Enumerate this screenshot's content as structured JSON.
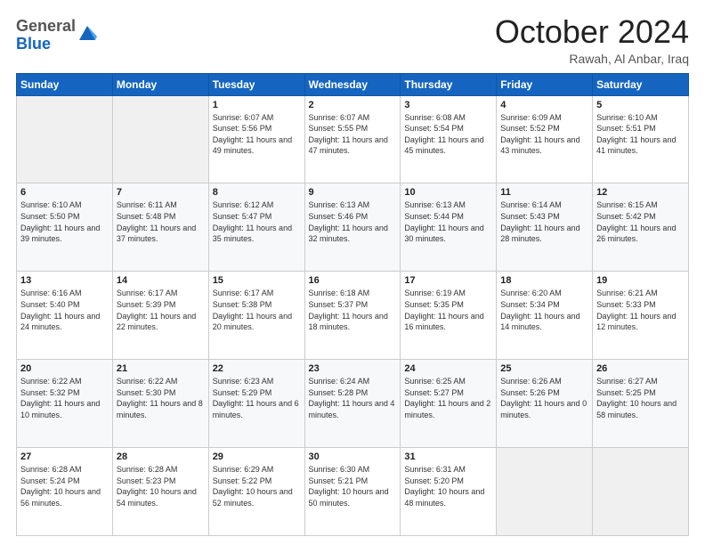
{
  "header": {
    "logo_general": "General",
    "logo_blue": "Blue",
    "month_title": "October 2024",
    "location": "Rawah, Al Anbar, Iraq"
  },
  "days_of_week": [
    "Sunday",
    "Monday",
    "Tuesday",
    "Wednesday",
    "Thursday",
    "Friday",
    "Saturday"
  ],
  "weeks": [
    [
      {
        "day": "",
        "info": ""
      },
      {
        "day": "",
        "info": ""
      },
      {
        "day": "1",
        "info": "Sunrise: 6:07 AM\nSunset: 5:56 PM\nDaylight: 11 hours and 49 minutes."
      },
      {
        "day": "2",
        "info": "Sunrise: 6:07 AM\nSunset: 5:55 PM\nDaylight: 11 hours and 47 minutes."
      },
      {
        "day": "3",
        "info": "Sunrise: 6:08 AM\nSunset: 5:54 PM\nDaylight: 11 hours and 45 minutes."
      },
      {
        "day": "4",
        "info": "Sunrise: 6:09 AM\nSunset: 5:52 PM\nDaylight: 11 hours and 43 minutes."
      },
      {
        "day": "5",
        "info": "Sunrise: 6:10 AM\nSunset: 5:51 PM\nDaylight: 11 hours and 41 minutes."
      }
    ],
    [
      {
        "day": "6",
        "info": "Sunrise: 6:10 AM\nSunset: 5:50 PM\nDaylight: 11 hours and 39 minutes."
      },
      {
        "day": "7",
        "info": "Sunrise: 6:11 AM\nSunset: 5:48 PM\nDaylight: 11 hours and 37 minutes."
      },
      {
        "day": "8",
        "info": "Sunrise: 6:12 AM\nSunset: 5:47 PM\nDaylight: 11 hours and 35 minutes."
      },
      {
        "day": "9",
        "info": "Sunrise: 6:13 AM\nSunset: 5:46 PM\nDaylight: 11 hours and 32 minutes."
      },
      {
        "day": "10",
        "info": "Sunrise: 6:13 AM\nSunset: 5:44 PM\nDaylight: 11 hours and 30 minutes."
      },
      {
        "day": "11",
        "info": "Sunrise: 6:14 AM\nSunset: 5:43 PM\nDaylight: 11 hours and 28 minutes."
      },
      {
        "day": "12",
        "info": "Sunrise: 6:15 AM\nSunset: 5:42 PM\nDaylight: 11 hours and 26 minutes."
      }
    ],
    [
      {
        "day": "13",
        "info": "Sunrise: 6:16 AM\nSunset: 5:40 PM\nDaylight: 11 hours and 24 minutes."
      },
      {
        "day": "14",
        "info": "Sunrise: 6:17 AM\nSunset: 5:39 PM\nDaylight: 11 hours and 22 minutes."
      },
      {
        "day": "15",
        "info": "Sunrise: 6:17 AM\nSunset: 5:38 PM\nDaylight: 11 hours and 20 minutes."
      },
      {
        "day": "16",
        "info": "Sunrise: 6:18 AM\nSunset: 5:37 PM\nDaylight: 11 hours and 18 minutes."
      },
      {
        "day": "17",
        "info": "Sunrise: 6:19 AM\nSunset: 5:35 PM\nDaylight: 11 hours and 16 minutes."
      },
      {
        "day": "18",
        "info": "Sunrise: 6:20 AM\nSunset: 5:34 PM\nDaylight: 11 hours and 14 minutes."
      },
      {
        "day": "19",
        "info": "Sunrise: 6:21 AM\nSunset: 5:33 PM\nDaylight: 11 hours and 12 minutes."
      }
    ],
    [
      {
        "day": "20",
        "info": "Sunrise: 6:22 AM\nSunset: 5:32 PM\nDaylight: 11 hours and 10 minutes."
      },
      {
        "day": "21",
        "info": "Sunrise: 6:22 AM\nSunset: 5:30 PM\nDaylight: 11 hours and 8 minutes."
      },
      {
        "day": "22",
        "info": "Sunrise: 6:23 AM\nSunset: 5:29 PM\nDaylight: 11 hours and 6 minutes."
      },
      {
        "day": "23",
        "info": "Sunrise: 6:24 AM\nSunset: 5:28 PM\nDaylight: 11 hours and 4 minutes."
      },
      {
        "day": "24",
        "info": "Sunrise: 6:25 AM\nSunset: 5:27 PM\nDaylight: 11 hours and 2 minutes."
      },
      {
        "day": "25",
        "info": "Sunrise: 6:26 AM\nSunset: 5:26 PM\nDaylight: 11 hours and 0 minutes."
      },
      {
        "day": "26",
        "info": "Sunrise: 6:27 AM\nSunset: 5:25 PM\nDaylight: 10 hours and 58 minutes."
      }
    ],
    [
      {
        "day": "27",
        "info": "Sunrise: 6:28 AM\nSunset: 5:24 PM\nDaylight: 10 hours and 56 minutes."
      },
      {
        "day": "28",
        "info": "Sunrise: 6:28 AM\nSunset: 5:23 PM\nDaylight: 10 hours and 54 minutes."
      },
      {
        "day": "29",
        "info": "Sunrise: 6:29 AM\nSunset: 5:22 PM\nDaylight: 10 hours and 52 minutes."
      },
      {
        "day": "30",
        "info": "Sunrise: 6:30 AM\nSunset: 5:21 PM\nDaylight: 10 hours and 50 minutes."
      },
      {
        "day": "31",
        "info": "Sunrise: 6:31 AM\nSunset: 5:20 PM\nDaylight: 10 hours and 48 minutes."
      },
      {
        "day": "",
        "info": ""
      },
      {
        "day": "",
        "info": ""
      }
    ]
  ]
}
